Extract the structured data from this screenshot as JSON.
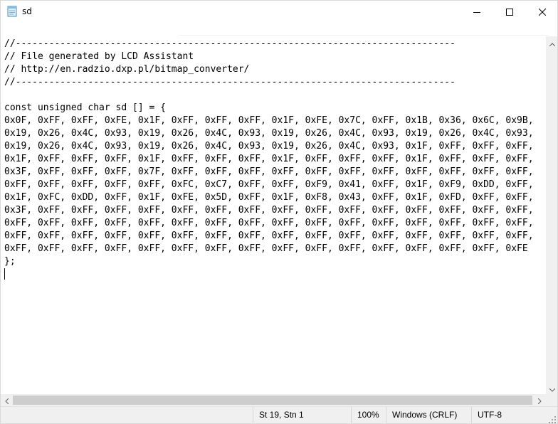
{
  "window": {
    "title": "sd",
    "icons": {
      "app": "notepad-icon",
      "minimize": "minimize-icon",
      "maximize": "maximize-icon",
      "close": "close-icon"
    }
  },
  "editor": {
    "lines": [
      "//-------------------------------------------------------------------------------",
      "// File generated by LCD Assistant",
      "// http://en.radzio.dxp.pl/bitmap_converter/",
      "//-------------------------------------------------------------------------------",
      "",
      "const unsigned char sd [] = {",
      "0x0F, 0xFF, 0xFF, 0xFE, 0x1F, 0xFF, 0xFF, 0xFF, 0x1F, 0xFE, 0x7C, 0xFF, 0x1B, 0x36, 0x6C, 0x9B,",
      "0x19, 0x26, 0x4C, 0x93, 0x19, 0x26, 0x4C, 0x93, 0x19, 0x26, 0x4C, 0x93, 0x19, 0x26, 0x4C, 0x93,",
      "0x19, 0x26, 0x4C, 0x93, 0x19, 0x26, 0x4C, 0x93, 0x19, 0x26, 0x4C, 0x93, 0x1F, 0xFF, 0xFF, 0xFF,",
      "0x1F, 0xFF, 0xFF, 0xFF, 0x1F, 0xFF, 0xFF, 0xFF, 0x1F, 0xFF, 0xFF, 0xFF, 0x1F, 0xFF, 0xFF, 0xFF,",
      "0x3F, 0xFF, 0xFF, 0xFF, 0x7F, 0xFF, 0xFF, 0xFF, 0xFF, 0xFF, 0xFF, 0xFF, 0xFF, 0xFF, 0xFF, 0xFF,",
      "0xFF, 0xFF, 0xFF, 0xFF, 0xFF, 0xFC, 0xC7, 0xFF, 0xFF, 0xF9, 0x41, 0xFF, 0x1F, 0xF9, 0xDD, 0xFF,",
      "0x1F, 0xFC, 0xDD, 0xFF, 0x1F, 0xFE, 0x5D, 0xFF, 0x1F, 0xF8, 0x43, 0xFF, 0x1F, 0xFD, 0xFF, 0xFF,",
      "0x3F, 0xFF, 0xFF, 0xFF, 0xFF, 0xFF, 0xFF, 0xFF, 0xFF, 0xFF, 0xFF, 0xFF, 0xFF, 0xFF, 0xFF, 0xFF,",
      "0xFF, 0xFF, 0xFF, 0xFF, 0xFF, 0xFF, 0xFF, 0xFF, 0xFF, 0xFF, 0xFF, 0xFF, 0xFF, 0xFF, 0xFF, 0xFF,",
      "0xFF, 0xFF, 0xFF, 0xFF, 0xFF, 0xFF, 0xFF, 0xFF, 0xFF, 0xFF, 0xFF, 0xFF, 0xFF, 0xFF, 0xFF, 0xFF,",
      "0xFF, 0xFF, 0xFF, 0xFF, 0xFF, 0xFF, 0xFF, 0xFF, 0xFF, 0xFF, 0xFF, 0xFF, 0xFF, 0xFF, 0xFF, 0xFE",
      "};"
    ]
  },
  "scrollbars": {
    "vertical": {
      "up": "arrow-up-icon",
      "down": "arrow-down-icon"
    },
    "horizontal": {
      "left": "arrow-left-icon",
      "right": "arrow-right-icon",
      "visible_fraction": 0.95
    }
  },
  "statusbar": {
    "position": "St 19, Stn 1",
    "zoom": "100%",
    "line_ending": "Windows (CRLF)",
    "encoding": "UTF-8"
  }
}
